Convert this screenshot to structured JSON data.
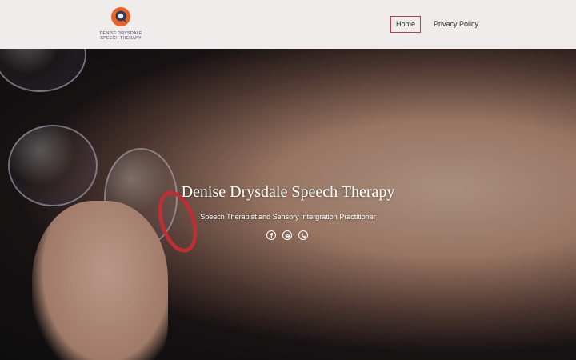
{
  "brand": {
    "logo_line1": "DENISE DRYSDALE",
    "logo_line2": "SPEECH THERAPY",
    "logo_icon": "speech-bubble-icon",
    "colors": {
      "logo_orange": "#e8632a",
      "logo_navy": "#2c3a5c"
    }
  },
  "nav": {
    "items": [
      {
        "label": "Home",
        "active": true
      },
      {
        "label": "Privacy Policy",
        "active": false
      }
    ],
    "active_border_color": "#b0435a"
  },
  "hero": {
    "title": "Denise Drysdale Speech Therapy",
    "subtitle": "Speech Therapist and Sensory Intergration Practitioner",
    "socials": [
      {
        "icon": "facebook-icon"
      },
      {
        "icon": "email-icon"
      },
      {
        "icon": "phone-icon"
      }
    ]
  }
}
